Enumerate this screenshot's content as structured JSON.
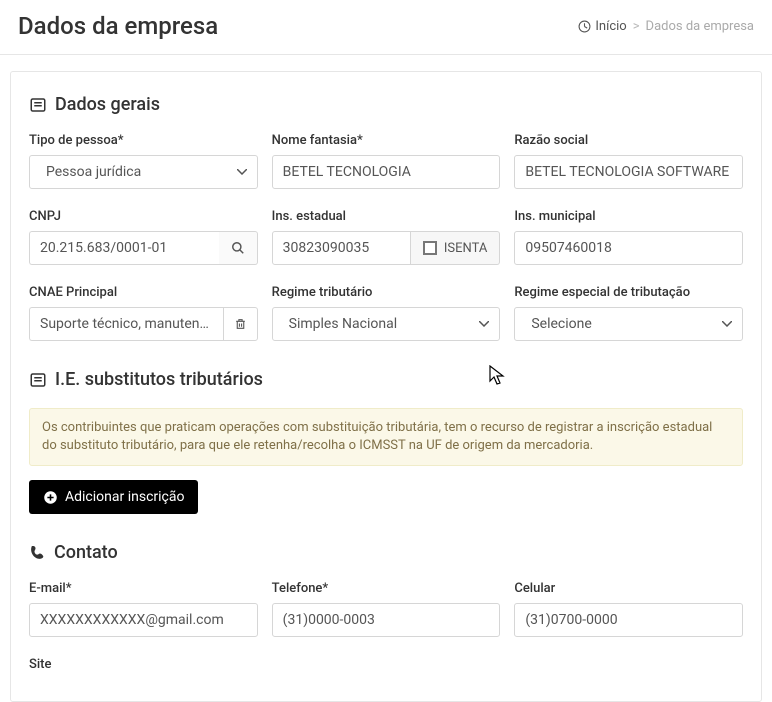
{
  "header": {
    "title": "Dados da empresa",
    "breadcrumb_home": "Início",
    "breadcrumb_current": "Dados da empresa"
  },
  "sections": {
    "gerais": {
      "title": "Dados gerais",
      "tipo_pessoa": {
        "label": "Tipo de pessoa*",
        "value": "Pessoa jurídica"
      },
      "nome_fantasia": {
        "label": "Nome fantasia*",
        "value": "BETEL TECNOLOGIA"
      },
      "razao_social": {
        "label": "Razão social",
        "value": "BETEL TECNOLOGIA SOFTWARE L"
      },
      "cnpj": {
        "label": "CNPJ",
        "value": "20.215.683/0001-01"
      },
      "ins_estadual": {
        "label": "Ins. estadual",
        "value": "30823090035",
        "isenta_label": "ISENTA"
      },
      "ins_municipal": {
        "label": "Ins. municipal",
        "value": "09507460018"
      },
      "cnae": {
        "label": "CNAE Principal",
        "value": "Suporte técnico, manutenção e outro"
      },
      "regime_trib": {
        "label": "Regime tributário",
        "value": "Simples Nacional"
      },
      "regime_esp": {
        "label": "Regime especial de tributação",
        "value": "Selecione"
      }
    },
    "iesub": {
      "title": "I.E. substitutos tributários",
      "info": "Os contribuintes que praticam operações com substituição tributária, tem o recurso de registrar a inscrição estadual do substituto tributário, para que ele retenha/recolha o ICMSST na UF de origem da mercadoria.",
      "add_btn": "Adicionar inscrição"
    },
    "contato": {
      "title": "Contato",
      "email": {
        "label": "E-mail*",
        "value": "XXXXXXXXXXXX@gmail.com"
      },
      "telefone": {
        "label": "Telefone*",
        "value": "(31)0000-0003"
      },
      "celular": {
        "label": "Celular",
        "value": "(31)0700-0000"
      },
      "site": {
        "label": "Site"
      }
    }
  }
}
